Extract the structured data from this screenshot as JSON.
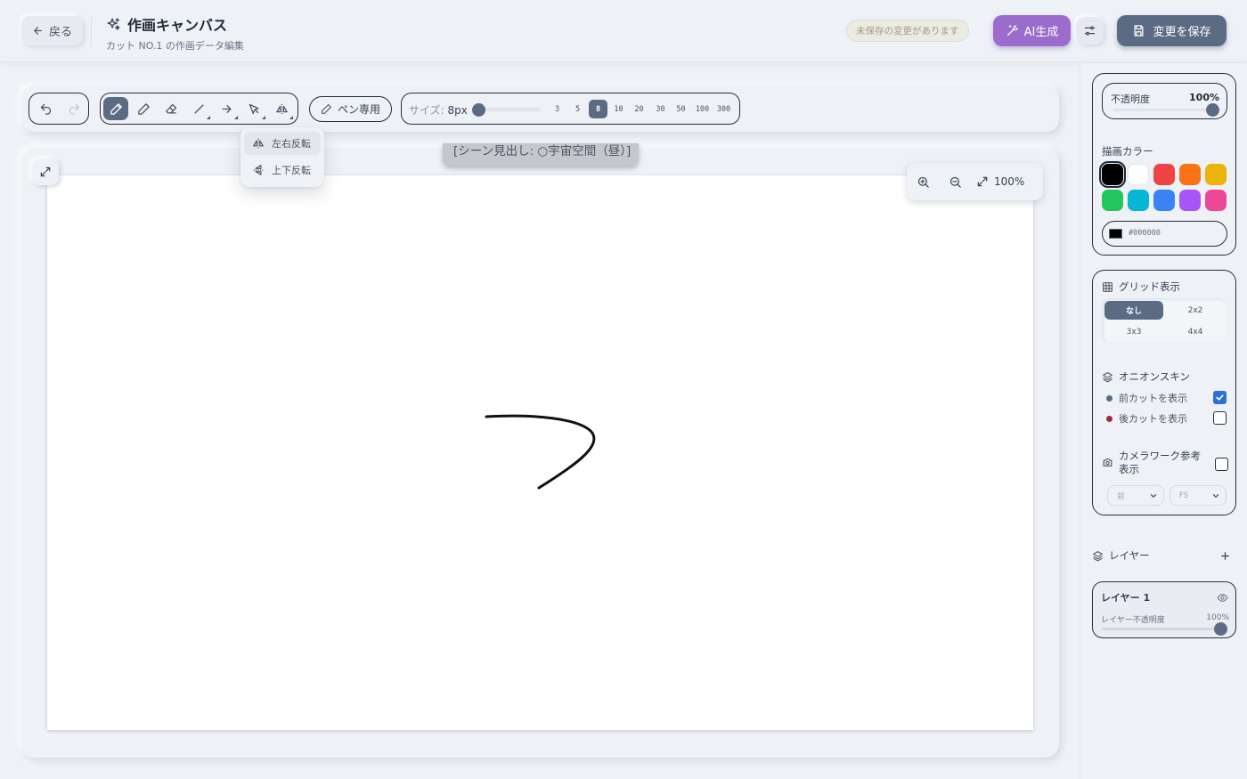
{
  "header": {
    "back_label": "戻る",
    "title": "作画キャンバス",
    "subtitle": "カット NO.1 の作画データ編集",
    "unsaved_label": "未保存の変更があります",
    "ai_label": "AI生成",
    "save_label": "変更を保存"
  },
  "toolbar": {
    "history": [
      "undo-icon",
      "redo-icon"
    ],
    "tools": [
      {
        "icon": "pen-icon",
        "active": true
      },
      {
        "icon": "pencil-icon",
        "active": false
      },
      {
        "icon": "eraser-icon",
        "active": false
      },
      {
        "icon": "line-icon",
        "active": false
      },
      {
        "icon": "arrow-icon",
        "active": false
      },
      {
        "icon": "select-icon",
        "active": false
      },
      {
        "icon": "flip-icon",
        "active": false
      }
    ],
    "pen_only_label": "ペン専用",
    "size_key": "サイズ:",
    "size_value": "8px",
    "size_presets": [
      "3",
      "5",
      "8",
      "10",
      "20",
      "30",
      "50",
      "100",
      "300"
    ],
    "size_selected": "8"
  },
  "flip_menu": {
    "items": [
      "左右反転",
      "上下反転"
    ]
  },
  "canvas": {
    "scene_label": "[シーン見出し: ○宇宙空間（昼）]",
    "zoom_label": "100%"
  },
  "right_panel": {
    "opacity_label": "不透明度",
    "opacity_value": "100%",
    "opacity_fraction": 1.0,
    "color_title": "描画カラー",
    "colors": [
      "#000000",
      "#ffffff",
      "#ef4444",
      "#f97316",
      "#eab308",
      "#22c55e",
      "#06b6d4",
      "#3b82f6",
      "#a855f7",
      "#ec4899"
    ],
    "selected_color": "#000000",
    "hex_value": "#000000",
    "grid_title": "グリッド表示",
    "grid_options": [
      "なし",
      "2x2",
      "3x3",
      "4x4"
    ],
    "grid_selected": "なし",
    "onion_title": "オニオンスキン",
    "onion_prev_label": "前カットを表示",
    "onion_prev_checked": true,
    "onion_prev_color": "#5c6b84",
    "onion_next_label": "後カットを表示",
    "onion_next_checked": false,
    "onion_next_color": "#9b2c3c",
    "camera_label": "カメラワーク参考表示",
    "camera_checked": false,
    "camera_select_1": "前",
    "camera_select_2": "FS",
    "layers_title": "レイヤー",
    "layers": [
      {
        "name": "レイヤー 1",
        "opacity_label": "レイヤー不透明度",
        "opacity_value": "100%",
        "opacity_fraction": 1.0
      }
    ]
  },
  "colors": {
    "accent": "#5c6b84",
    "ai_purple": "#9b6ccb",
    "background": "#eef1f6"
  }
}
